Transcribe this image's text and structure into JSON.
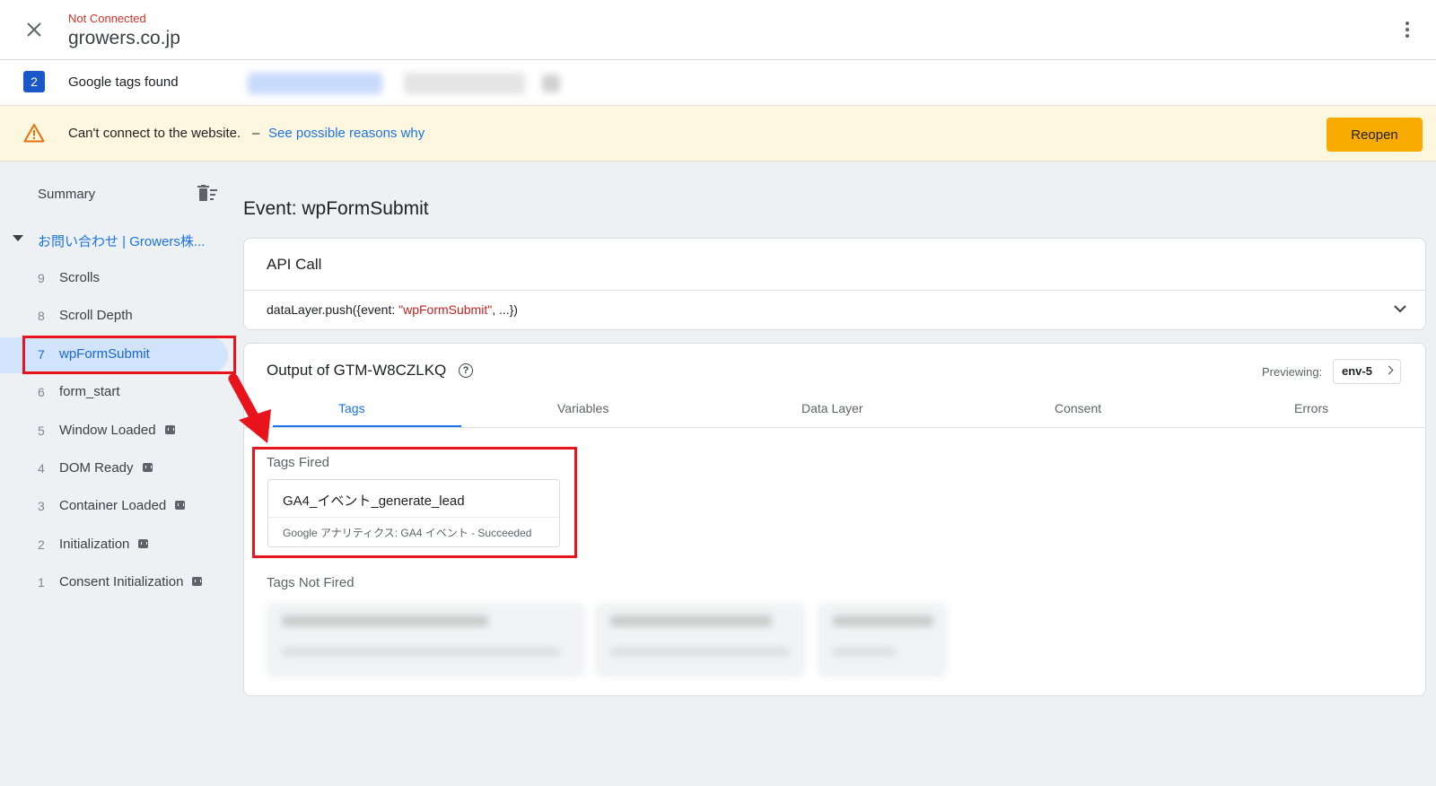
{
  "header": {
    "connection_status": "Not Connected",
    "domain": "growers.co.jp"
  },
  "tags_bar": {
    "count": "2",
    "label": "Google tags found"
  },
  "warning": {
    "message": "Can't connect to the website.",
    "separator": "–",
    "link": "See possible reasons why",
    "button": "Reopen",
    "accent_color": "#f9ab00"
  },
  "sidebar": {
    "summary": "Summary",
    "page": "お問い合わせ | Growers株...",
    "events": [
      {
        "num": "9",
        "label": "Scrolls",
        "api": false
      },
      {
        "num": "8",
        "label": "Scroll Depth",
        "api": false
      },
      {
        "num": "7",
        "label": "wpFormSubmit",
        "api": false,
        "selected": true
      },
      {
        "num": "6",
        "label": "form_start",
        "api": false
      },
      {
        "num": "5",
        "label": "Window Loaded",
        "api": true
      },
      {
        "num": "4",
        "label": "DOM Ready",
        "api": true
      },
      {
        "num": "3",
        "label": "Container Loaded",
        "api": true
      },
      {
        "num": "2",
        "label": "Initialization",
        "api": true
      },
      {
        "num": "1",
        "label": "Consent Initialization",
        "api": true
      }
    ]
  },
  "main": {
    "event_title": "Event: wpFormSubmit",
    "api_call": {
      "title": "API Call",
      "code_prefix": "dataLayer.push({event: ",
      "code_string": "\"wpFormSubmit\"",
      "code_suffix": ", ...})"
    },
    "output": {
      "title": "Output of GTM-W8CZLKQ",
      "previewing_label": "Previewing:",
      "env": "env-5",
      "tabs": [
        "Tags",
        "Variables",
        "Data Layer",
        "Consent",
        "Errors"
      ],
      "active_tab": "Tags",
      "tags_fired_label": "Tags Fired",
      "fired_tag": {
        "name": "GA4_イベント_generate_lead",
        "subtitle": "Google アナリティクス: GA4 イベント - Succeeded"
      },
      "tags_not_fired_label": "Tags Not Fired"
    }
  },
  "colors": {
    "link_blue": "#1a73e8",
    "highlight_red": "#e8141c",
    "selected_bg": "#d2e3fc"
  }
}
